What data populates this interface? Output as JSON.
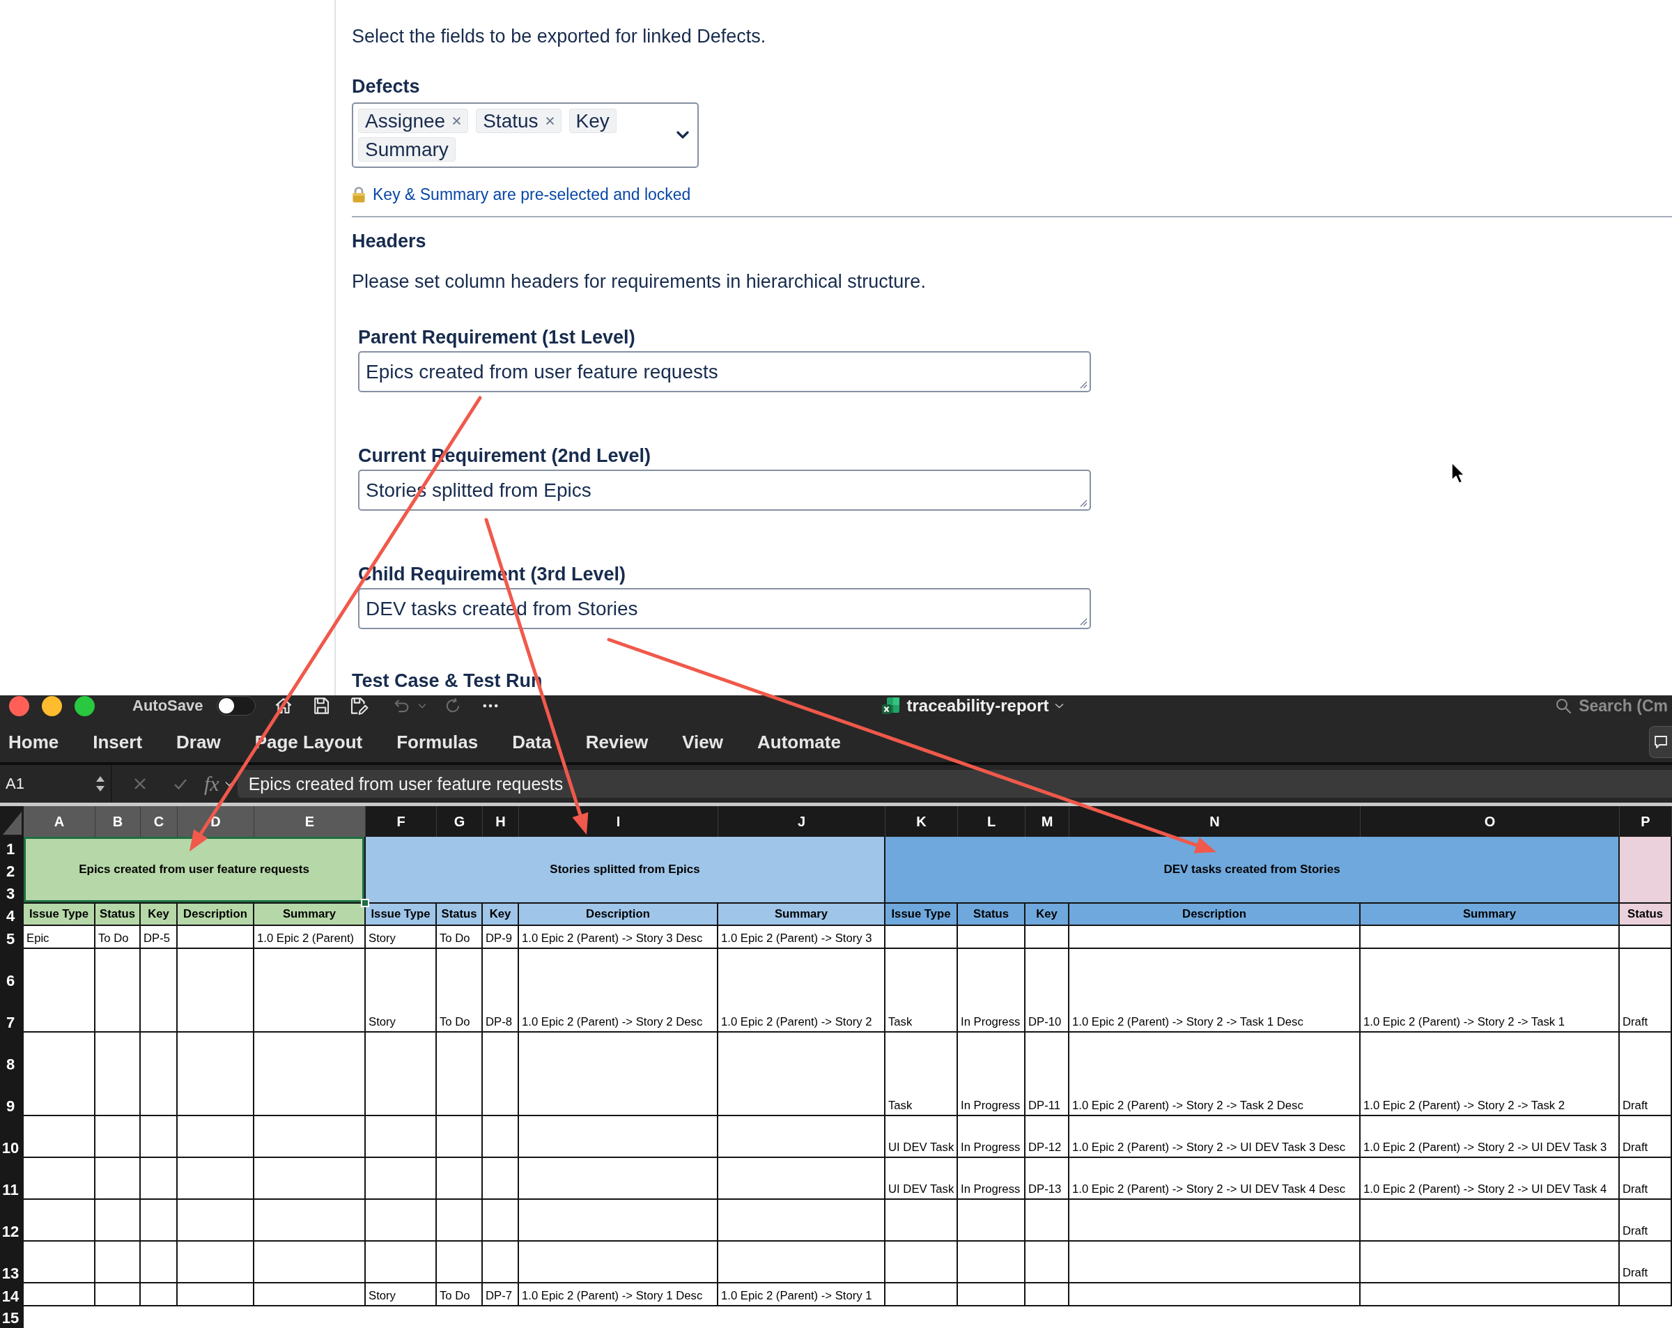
{
  "form": {
    "intro": "Select the fields to be exported for linked Defects.",
    "defects": {
      "label": "Defects",
      "tags": [
        {
          "text": "Assignee",
          "locked": false
        },
        {
          "text": "Status",
          "locked": false
        },
        {
          "text": "Key",
          "locked": true
        },
        {
          "text": "Summary",
          "locked": true
        }
      ],
      "note": "Key & Summary are pre-selected and locked"
    },
    "headers": {
      "title": "Headers",
      "description": "Please set column headers for requirements in hierarchical structure.",
      "fields": [
        {
          "label": "Parent Requirement (1st Level)",
          "value": "Epics created from user feature requests"
        },
        {
          "label": "Current Requirement (2nd Level)",
          "value": "Stories splitted from Epics"
        },
        {
          "label": "Child Requirement (3rd Level)",
          "value": "DEV tasks created from Stories"
        }
      ]
    },
    "next_section": "Test Case & Test Run"
  },
  "excel": {
    "title_bar": {
      "autosave": {
        "label": "AutoSave",
        "on": false
      },
      "document_title": "traceability-report",
      "search": {
        "placeholder": "Search (Cm"
      }
    },
    "ribbon_tabs": [
      {
        "label": "Home",
        "selected": false
      },
      {
        "label": "Insert",
        "selected": false
      },
      {
        "label": "Draw",
        "selected": false
      },
      {
        "label": "Page Layout",
        "selected": false
      },
      {
        "label": "Formulas",
        "selected": false
      },
      {
        "label": "Data",
        "selected": false
      },
      {
        "label": "Review",
        "selected": false
      },
      {
        "label": "View",
        "selected": false
      },
      {
        "label": "Automate",
        "selected": false
      }
    ],
    "formula_bar": {
      "name_box": "A1",
      "function_label": "fx",
      "formula": "Epics created from user feature requests"
    },
    "sheet": {
      "columns": [
        {
          "letter": "A",
          "selected": true
        },
        {
          "letter": "B",
          "selected": true
        },
        {
          "letter": "C",
          "selected": true
        },
        {
          "letter": "D",
          "selected": true
        },
        {
          "letter": "E",
          "selected": true
        },
        {
          "letter": "F",
          "selected": false
        },
        {
          "letter": "G",
          "selected": false
        },
        {
          "letter": "H",
          "selected": false
        },
        {
          "letter": "I",
          "selected": false
        },
        {
          "letter": "J",
          "selected": false
        },
        {
          "letter": "K",
          "selected": false
        },
        {
          "letter": "L",
          "selected": false
        },
        {
          "letter": "M",
          "selected": false
        },
        {
          "letter": "N",
          "selected": false
        },
        {
          "letter": "O",
          "selected": false
        },
        {
          "letter": "P",
          "selected": false
        }
      ],
      "band": {
        "row_numbers": [
          "1",
          "2",
          "3"
        ],
        "groups": [
          {
            "title": "Epics created from user feature requests",
            "color": "#b6d7a8",
            "selected": true,
            "headers": [
              "Issue Type",
              "Status",
              "Key",
              "Description",
              "Summary"
            ]
          },
          {
            "title": "Stories splitted from Epics",
            "color": "#9fc5e8",
            "selected": false,
            "headers": [
              "Issue Type",
              "Status",
              "Key",
              "Description",
              "Summary"
            ]
          },
          {
            "title": "DEV tasks created from Stories",
            "color": "#6fa8dc",
            "selected": false,
            "headers": [
              "Issue Type",
              "Status",
              "Key",
              "Description",
              "Summary"
            ]
          },
          {
            "color": "#ead1dc",
            "selected": false,
            "headers": [
              "Status"
            ]
          }
        ]
      },
      "header_row_number": "4",
      "rows": [
        {
          "numbers": [
            "5"
          ],
          "cells": [
            "Epic",
            "To Do",
            "DP-5",
            null,
            "1.0 Epic 2 (Parent)",
            "Story",
            "To Do",
            "DP-9",
            "1.0 Epic 2 (Parent) -> Story 3 Desc",
            "1.0 Epic 2 (Parent) -> Story 3",
            null,
            null,
            null,
            null,
            null,
            null
          ]
        },
        {
          "numbers": [
            "6",
            "7"
          ],
          "cells": [
            null,
            null,
            null,
            null,
            null,
            "Story",
            "To Do",
            "DP-8",
            "1.0 Epic 2 (Parent) -> Story 2 Desc",
            "1.0 Epic 2 (Parent) -> Story 2",
            "Task",
            "In Progress",
            "DP-10",
            "1.0 Epic 2 (Parent) -> Story 2 -> Task 1 Desc",
            "1.0 Epic 2 (Parent) -> Story 2 -> Task 1",
            "Draft"
          ]
        },
        {
          "numbers": [
            "8",
            "9"
          ],
          "cells": [
            null,
            null,
            null,
            null,
            null,
            null,
            null,
            null,
            null,
            null,
            "Task",
            "In Progress",
            "DP-11",
            "1.0 Epic 2 (Parent) -> Story 2 -> Task 2 Desc",
            "1.0 Epic 2 (Parent) -> Story 2 -> Task 2",
            "Draft"
          ]
        },
        {
          "numbers": [
            "10"
          ],
          "cells": [
            null,
            null,
            null,
            null,
            null,
            null,
            null,
            null,
            null,
            null,
            "UI DEV Task",
            "In Progress",
            "DP-12",
            "1.0 Epic 2 (Parent) -> Story 2 -> UI DEV Task 3 Desc",
            "1.0 Epic 2 (Parent) -> Story 2 -> UI DEV Task 3",
            "Draft"
          ]
        },
        {
          "numbers": [
            "11"
          ],
          "cells": [
            null,
            null,
            null,
            null,
            null,
            null,
            null,
            null,
            null,
            null,
            "UI DEV Task",
            "In Progress",
            "DP-13",
            "1.0 Epic 2 (Parent) -> Story 2 -> UI DEV Task 4 Desc",
            "1.0 Epic 2 (Parent) -> Story 2 -> UI DEV Task 4",
            "Draft"
          ]
        },
        {
          "numbers": [
            "12"
          ],
          "cells": [
            null,
            null,
            null,
            null,
            null,
            null,
            null,
            null,
            null,
            null,
            null,
            null,
            null,
            null,
            null,
            "Draft"
          ]
        },
        {
          "numbers": [
            "13"
          ],
          "cells": [
            null,
            null,
            null,
            null,
            null,
            null,
            null,
            null,
            null,
            null,
            null,
            null,
            null,
            null,
            null,
            "Draft"
          ]
        },
        {
          "numbers": [
            "14"
          ],
          "cells": [
            null,
            null,
            null,
            null,
            null,
            "Story",
            "To Do",
            "DP-7",
            "1.0 Epic 2 (Parent) -> Story 1 Desc",
            "1.0 Epic 2 (Parent) -> Story 1",
            null,
            null,
            null,
            null,
            null,
            null
          ]
        }
      ],
      "trailing_row_numbers": [
        "15"
      ]
    }
  }
}
